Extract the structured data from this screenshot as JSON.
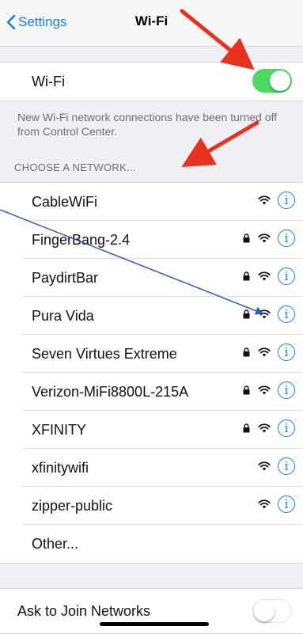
{
  "nav": {
    "back_label": "Settings",
    "title": "Wi-Fi"
  },
  "wifi_toggle": {
    "label": "Wi-Fi",
    "on": true
  },
  "note": "New Wi-Fi network connections have been turned off from Control Center.",
  "section_header": "CHOOSE A NETWORK...",
  "networks": [
    {
      "name": "CableWiFi",
      "locked": false
    },
    {
      "name": "FingerBang-2.4",
      "locked": true
    },
    {
      "name": "PaydirtBar",
      "locked": true
    },
    {
      "name": "Pura Vida",
      "locked": true
    },
    {
      "name": "Seven Virtues Extreme",
      "locked": true
    },
    {
      "name": "Verizon-MiFi8800L-215A",
      "locked": true
    },
    {
      "name": "XFINITY",
      "locked": true
    },
    {
      "name": "xfinitywifi",
      "locked": false
    },
    {
      "name": "zipper-public",
      "locked": false
    },
    {
      "name": "Other...",
      "locked": false,
      "other": true
    }
  ],
  "ask_to_join": {
    "label": "Ask to Join Networks",
    "on": false
  },
  "colors": {
    "accent": "#1a7cf5",
    "toggle_on": "#4cd964",
    "annotation_red": "#e8321f",
    "annotation_blue": "#2b5fb5"
  }
}
